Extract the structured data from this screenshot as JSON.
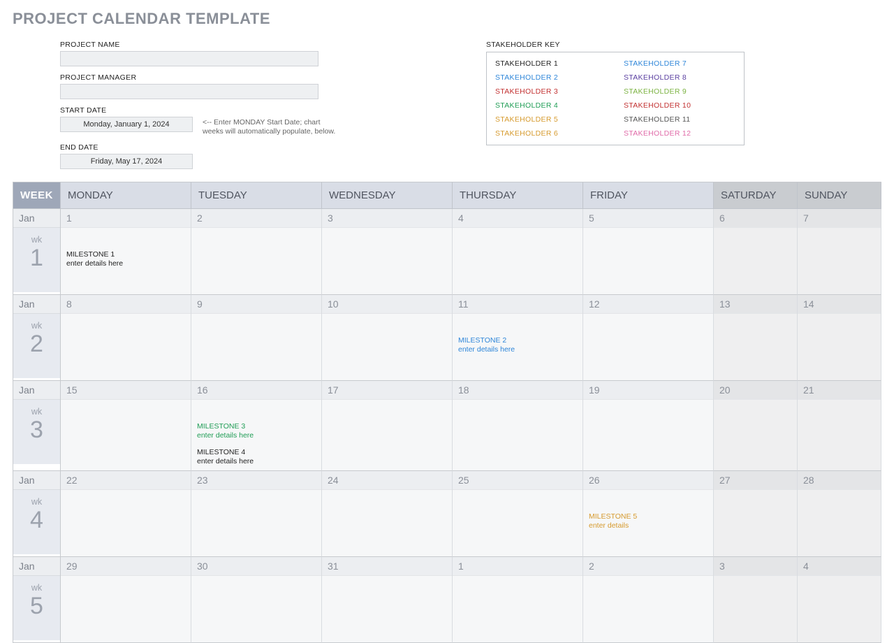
{
  "page_title": "PROJECT CALENDAR TEMPLATE",
  "form": {
    "project_name_label": "PROJECT NAME",
    "project_name_value": "",
    "project_manager_label": "PROJECT MANAGER",
    "project_manager_value": "",
    "start_date_label": "START DATE",
    "start_date_value": "Monday, January 1, 2024",
    "start_date_hint": "<-- Enter MONDAY Start Date; chart weeks will automatically populate, below.",
    "end_date_label": "END DATE",
    "end_date_value": "Friday, May 17, 2024"
  },
  "stakeholder_key_label": "STAKEHOLDER KEY",
  "stakeholders": [
    {
      "label": "STAKEHOLDER 1",
      "color": "#222222"
    },
    {
      "label": "STAKEHOLDER 7",
      "color": "#2e86d9"
    },
    {
      "label": "STAKEHOLDER 2",
      "color": "#2e86d9"
    },
    {
      "label": "STAKEHOLDER 8",
      "color": "#5a3fa0"
    },
    {
      "label": "STAKEHOLDER 3",
      "color": "#c23030"
    },
    {
      "label": "STAKEHOLDER 9",
      "color": "#7cb342"
    },
    {
      "label": "STAKEHOLDER 4",
      "color": "#1f9d55"
    },
    {
      "label": "STAKEHOLDER 10",
      "color": "#c23030"
    },
    {
      "label": "STAKEHOLDER 5",
      "color": "#d69a2d"
    },
    {
      "label": "STAKEHOLDER 11",
      "color": "#555555"
    },
    {
      "label": "STAKEHOLDER 6",
      "color": "#d69a2d"
    },
    {
      "label": "STAKEHOLDER 12",
      "color": "#e06aa8"
    }
  ],
  "calendar": {
    "week_header": "WEEK",
    "day_headers": [
      "MONDAY",
      "TUESDAY",
      "WEDNESDAY",
      "THURSDAY",
      "FRIDAY",
      "SATURDAY",
      "SUNDAY"
    ],
    "wk_label": "wk",
    "weeks": [
      {
        "month_label": "Jan",
        "week_number": "1",
        "days": [
          {
            "date": "1",
            "weekend": false,
            "milestones": [
              {
                "title": "MILESTONE 1",
                "detail": "enter details here",
                "color": "#222222"
              }
            ]
          },
          {
            "date": "2",
            "weekend": false,
            "milestones": []
          },
          {
            "date": "3",
            "weekend": false,
            "milestones": []
          },
          {
            "date": "4",
            "weekend": false,
            "milestones": []
          },
          {
            "date": "5",
            "weekend": false,
            "milestones": []
          },
          {
            "date": "6",
            "weekend": true,
            "milestones": []
          },
          {
            "date": "7",
            "weekend": true,
            "milestones": []
          }
        ]
      },
      {
        "month_label": "Jan",
        "week_number": "2",
        "days": [
          {
            "date": "8",
            "weekend": false,
            "milestones": []
          },
          {
            "date": "9",
            "weekend": false,
            "milestones": []
          },
          {
            "date": "10",
            "weekend": false,
            "milestones": []
          },
          {
            "date": "11",
            "weekend": false,
            "milestones": [
              {
                "title": "MILESTONE 2",
                "detail": "enter details here",
                "color": "#2e86d9"
              }
            ]
          },
          {
            "date": "12",
            "weekend": false,
            "milestones": []
          },
          {
            "date": "13",
            "weekend": true,
            "milestones": []
          },
          {
            "date": "14",
            "weekend": true,
            "milestones": []
          }
        ]
      },
      {
        "month_label": "Jan",
        "week_number": "3",
        "days": [
          {
            "date": "15",
            "weekend": false,
            "milestones": []
          },
          {
            "date": "16",
            "weekend": false,
            "milestones": [
              {
                "title": "MILESTONE 3",
                "detail": "enter details here",
                "color": "#1f9d55"
              },
              {
                "title": "MILESTONE 4",
                "detail": "enter details here",
                "color": "#222222"
              }
            ]
          },
          {
            "date": "17",
            "weekend": false,
            "milestones": []
          },
          {
            "date": "18",
            "weekend": false,
            "milestones": []
          },
          {
            "date": "19",
            "weekend": false,
            "milestones": []
          },
          {
            "date": "20",
            "weekend": true,
            "milestones": []
          },
          {
            "date": "21",
            "weekend": true,
            "milestones": []
          }
        ]
      },
      {
        "month_label": "Jan",
        "week_number": "4",
        "days": [
          {
            "date": "22",
            "weekend": false,
            "milestones": []
          },
          {
            "date": "23",
            "weekend": false,
            "milestones": []
          },
          {
            "date": "24",
            "weekend": false,
            "milestones": []
          },
          {
            "date": "25",
            "weekend": false,
            "milestones": []
          },
          {
            "date": "26",
            "weekend": false,
            "milestones": [
              {
                "title": "MILESTONE 5",
                "detail": "enter details",
                "color": "#d69a2d"
              }
            ]
          },
          {
            "date": "27",
            "weekend": true,
            "milestones": []
          },
          {
            "date": "28",
            "weekend": true,
            "milestones": []
          }
        ]
      },
      {
        "month_label": "Jan",
        "week_number": "5",
        "days": [
          {
            "date": "29",
            "weekend": false,
            "milestones": []
          },
          {
            "date": "30",
            "weekend": false,
            "milestones": []
          },
          {
            "date": "31",
            "weekend": false,
            "milestones": []
          },
          {
            "date": "1",
            "weekend": false,
            "milestones": []
          },
          {
            "date": "2",
            "weekend": false,
            "milestones": []
          },
          {
            "date": "3",
            "weekend": true,
            "milestones": []
          },
          {
            "date": "4",
            "weekend": true,
            "milestones": []
          }
        ]
      }
    ]
  }
}
